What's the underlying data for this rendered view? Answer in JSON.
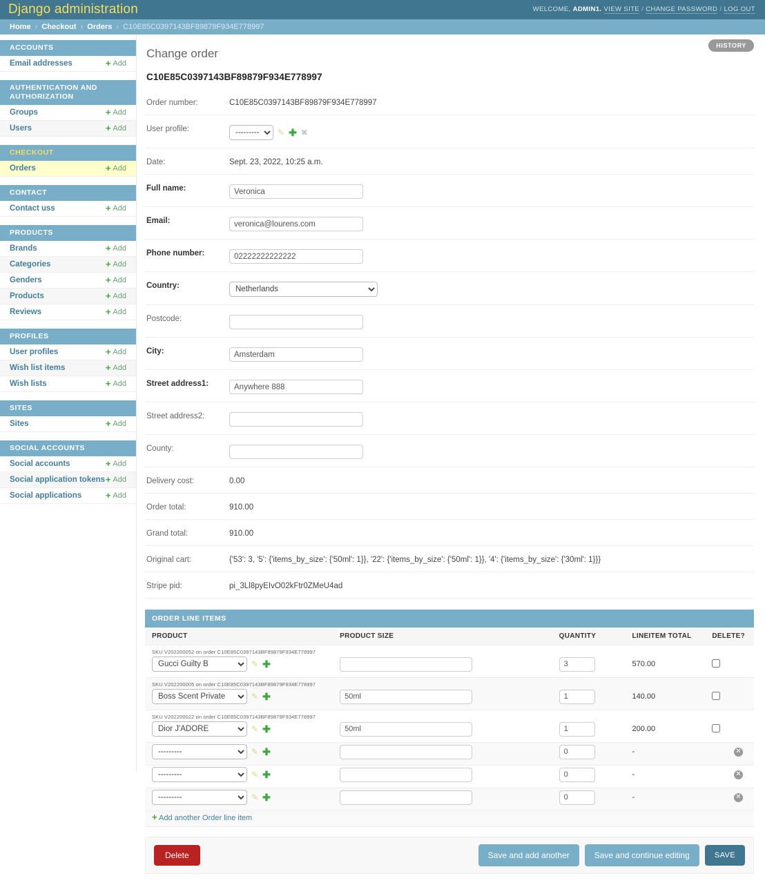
{
  "header": {
    "site_title": "Django administration",
    "welcome_prefix": "WELCOME,",
    "username": "ADMIN1.",
    "view_site": "VIEW SITE",
    "change_password": "CHANGE PASSWORD",
    "log_out": "LOG OUT",
    "sep": "/"
  },
  "breadcrumbs": {
    "home": "Home",
    "app": "Checkout",
    "model": "Orders",
    "current": "C10E85C0397143BF89879F934E778997",
    "separator": "›"
  },
  "sidebar": {
    "add_label": "Add",
    "groups": [
      {
        "caption": "ACCOUNTS",
        "current": false,
        "models": [
          {
            "label": "Email addresses",
            "selected": false
          }
        ]
      },
      {
        "caption": "AUTHENTICATION AND AUTHORIZATION",
        "current": false,
        "models": [
          {
            "label": "Groups",
            "selected": false
          },
          {
            "label": "Users",
            "selected": false
          }
        ]
      },
      {
        "caption": "CHECKOUT",
        "current": true,
        "models": [
          {
            "label": "Orders",
            "selected": true
          }
        ]
      },
      {
        "caption": "CONTACT",
        "current": false,
        "models": [
          {
            "label": "Contact uss",
            "selected": false
          }
        ]
      },
      {
        "caption": "PRODUCTS",
        "current": false,
        "models": [
          {
            "label": "Brands",
            "selected": false
          },
          {
            "label": "Categories",
            "selected": false
          },
          {
            "label": "Genders",
            "selected": false
          },
          {
            "label": "Products",
            "selected": false
          },
          {
            "label": "Reviews",
            "selected": false
          }
        ]
      },
      {
        "caption": "PROFILES",
        "current": false,
        "models": [
          {
            "label": "User profiles",
            "selected": false
          },
          {
            "label": "Wish list items",
            "selected": false
          },
          {
            "label": "Wish lists",
            "selected": false
          }
        ]
      },
      {
        "caption": "SITES",
        "current": false,
        "models": [
          {
            "label": "Sites",
            "selected": false
          }
        ]
      },
      {
        "caption": "SOCIAL ACCOUNTS",
        "current": false,
        "models": [
          {
            "label": "Social accounts",
            "selected": false
          },
          {
            "label": "Social application tokens",
            "selected": false
          },
          {
            "label": "Social applications",
            "selected": false
          }
        ]
      }
    ]
  },
  "main": {
    "page_title": "Change order",
    "history_label": "HISTORY",
    "object_name": "C10E85C0397143BF89879F934E778997",
    "fields": [
      {
        "label": "Order number:",
        "required": false,
        "type": "readonly",
        "value": "C10E85C0397143BF89879F934E778997"
      },
      {
        "label": "User profile:",
        "required": false,
        "type": "select-related",
        "value": "---------",
        "icons": [
          "pencil-icon",
          "plus-icon",
          "x-icon"
        ]
      },
      {
        "label": "Date:",
        "required": false,
        "type": "readonly",
        "value": "Sept. 23, 2022, 10:25 a.m."
      },
      {
        "label": "Full name:",
        "required": true,
        "type": "text",
        "value": "Veronica",
        "placeholder": ""
      },
      {
        "label": "Email:",
        "required": true,
        "type": "text",
        "value": "veronica@lourens.com",
        "placeholder": ""
      },
      {
        "label": "Phone number:",
        "required": true,
        "type": "text",
        "value": "02222222222222",
        "placeholder": ""
      },
      {
        "label": "Country:",
        "required": true,
        "type": "select",
        "value": "Netherlands"
      },
      {
        "label": "Postcode:",
        "required": false,
        "type": "text",
        "value": "",
        "placeholder": ""
      },
      {
        "label": "City:",
        "required": true,
        "type": "text",
        "value": "Amsterdam",
        "placeholder": ""
      },
      {
        "label": "Street address1:",
        "required": true,
        "type": "text",
        "value": "Anywhere 888",
        "placeholder": ""
      },
      {
        "label": "Street address2:",
        "required": false,
        "type": "text",
        "value": "",
        "placeholder": ""
      },
      {
        "label": "County:",
        "required": false,
        "type": "text",
        "value": "",
        "placeholder": ""
      },
      {
        "label": "Delivery cost:",
        "required": false,
        "type": "readonly",
        "value": "0.00"
      },
      {
        "label": "Order total:",
        "required": false,
        "type": "readonly",
        "value": "910.00"
      },
      {
        "label": "Grand total:",
        "required": false,
        "type": "readonly",
        "value": "910.00"
      },
      {
        "label": "Original cart:",
        "required": false,
        "type": "readonly",
        "value": "{'53': 3, '5': {'items_by_size': {'50ml': 1}}, '22': {'items_by_size': {'50ml': 1}}, '4': {'items_by_size': {'30ml': 1}}}"
      },
      {
        "label": "Stripe pid:",
        "required": false,
        "type": "readonly",
        "value": "pi_3Ll8pyEIvO02kFtr0ZMeU4ad"
      }
    ],
    "inline": {
      "heading": "ORDER LINE ITEMS",
      "columns": [
        "PRODUCT",
        "PRODUCT SIZE",
        "QUANTITY",
        "LINEITEM TOTAL",
        "DELETE?"
      ],
      "rows": [
        {
          "sku": "SKU V202200052 on order C10E85C0397143BF89879F934E778997",
          "product": "Gucci Guilty B",
          "product_size": "",
          "quantity": "3",
          "lineitem_total": "570.00",
          "deletable": "checkbox"
        },
        {
          "sku": "SKU V202200005 on order C10E85C0397143BF89879F934E778997",
          "product": "Boss Scent Private",
          "product_size": "50ml",
          "quantity": "1",
          "lineitem_total": "140.00",
          "deletable": "checkbox"
        },
        {
          "sku": "SKU V202200022 on order C10E85C0397143BF89879F934E778997",
          "product": "Dior J'ADORE",
          "product_size": "50ml",
          "quantity": "1",
          "lineitem_total": "200.00",
          "deletable": "checkbox"
        },
        {
          "sku": "",
          "product": "---------",
          "product_size": "",
          "quantity": "0",
          "lineitem_total": "-",
          "deletable": "remove"
        },
        {
          "sku": "",
          "product": "---------",
          "product_size": "",
          "quantity": "0",
          "lineitem_total": "-",
          "deletable": "remove"
        },
        {
          "sku": "",
          "product": "---------",
          "product_size": "",
          "quantity": "0",
          "lineitem_total": "-",
          "deletable": "remove"
        }
      ],
      "add_another": "Add another Order line item"
    },
    "submit_row": {
      "delete": "Delete",
      "save_and_add_another": "Save and add another",
      "save_and_continue": "Save and continue editing",
      "save": "SAVE"
    }
  },
  "colors": {
    "header_bg": "#417690",
    "breadcrumb_bg": "#79aec8",
    "brand_text": "#f5dd5d",
    "link": "#447e9b",
    "delete_bg": "#ba2121",
    "selected_row": "#ffffcc",
    "add_green": "#3ba83b"
  }
}
